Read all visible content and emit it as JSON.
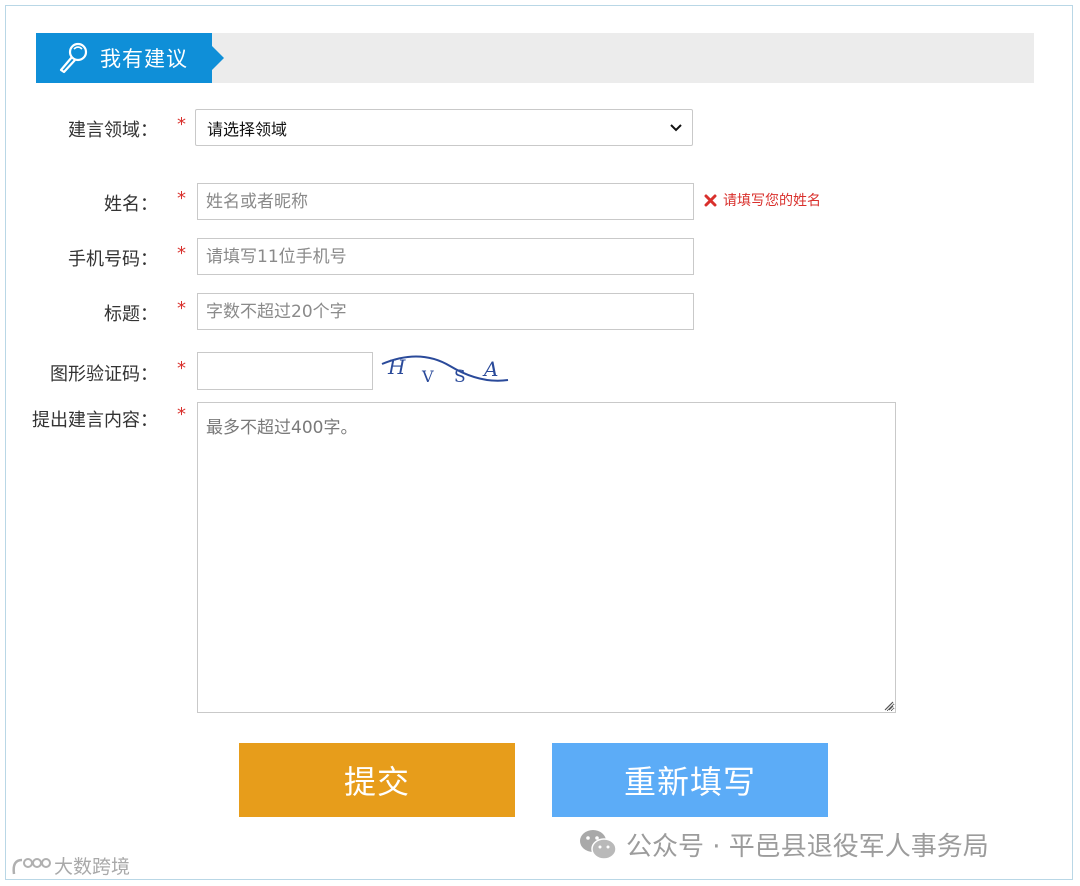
{
  "header": {
    "title": "我有建议",
    "icon": "microphone-icon"
  },
  "form": {
    "domain": {
      "label": "建言领域：",
      "required_mark": "*",
      "selected": "请选择领域"
    },
    "name": {
      "label": "姓名：",
      "required_mark": "*",
      "placeholder": "姓名或者昵称",
      "error": "请填写您的姓名"
    },
    "phone": {
      "label": "手机号码：",
      "required_mark": "*",
      "placeholder": "请填写11位手机号"
    },
    "title": {
      "label": "标题：",
      "required_mark": "*",
      "placeholder": "字数不超过20个字"
    },
    "captcha": {
      "label": "图形验证码：",
      "required_mark": "*",
      "value": "",
      "image_text": "HVSA"
    },
    "content": {
      "label": "提出建言内容：",
      "required_mark": "*",
      "placeholder": "最多不超过400字。"
    }
  },
  "buttons": {
    "submit": "提交",
    "reset": "重新填写"
  },
  "watermarks": {
    "wechat": "公众号 · 平邑县退役军人事务局",
    "corner": "大数跨境"
  },
  "colors": {
    "header_blue": "#0f8fd8",
    "submit_orange": "#e79d1b",
    "reset_blue": "#5cacf7",
    "required_red": "#d9302c"
  }
}
